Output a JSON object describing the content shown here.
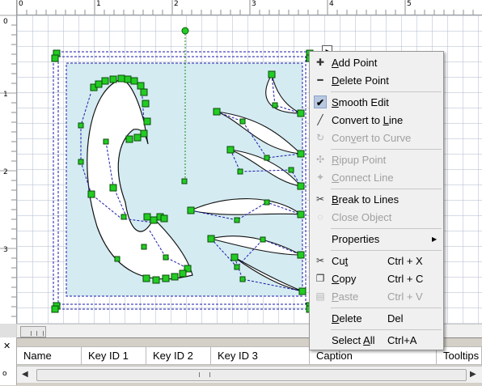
{
  "ruler": {
    "top_labels": [
      "0",
      "1",
      "2",
      "3",
      "4",
      "5"
    ],
    "left_labels": [
      "0",
      "1",
      "2",
      "3"
    ]
  },
  "canvas": {
    "background_color": "#ffffff",
    "shape_fill": "#d4ebf2",
    "handle_color": "#22cc22",
    "dashed_color": "#1a1aaa"
  },
  "context_menu": {
    "items": [
      {
        "label": "Add Point",
        "mnemonic": "A",
        "icon": "add-point-icon",
        "enabled": true
      },
      {
        "label": "Delete Point",
        "mnemonic": "D",
        "icon": "delete-point-icon",
        "enabled": true
      },
      {
        "separator": true
      },
      {
        "label": "Smooth Edit",
        "mnemonic": "S",
        "icon": "checkmark-icon",
        "enabled": true,
        "checked": true
      },
      {
        "label": "Convert to Line",
        "mnemonic": "L",
        "icon": "convert-line-icon",
        "enabled": true
      },
      {
        "label": "Convert to Curve",
        "mnemonic": "v",
        "icon": "convert-curve-icon",
        "enabled": false
      },
      {
        "separator": true
      },
      {
        "label": "Ripup Point",
        "mnemonic": "R",
        "icon": "ripup-point-icon",
        "enabled": false
      },
      {
        "label": "Connect Line",
        "mnemonic": "C",
        "icon": "connect-line-icon",
        "enabled": false
      },
      {
        "separator": true
      },
      {
        "label": "Break to Lines",
        "mnemonic": "B",
        "icon": "break-lines-icon",
        "enabled": true
      },
      {
        "label": "Close Object",
        "mnemonic": "",
        "icon": "close-object-icon",
        "enabled": false
      },
      {
        "separator": true
      },
      {
        "label": "Properties",
        "mnemonic": "",
        "icon": "",
        "enabled": true,
        "submenu": true
      },
      {
        "separator": true
      },
      {
        "label": "Cut",
        "mnemonic": "t",
        "icon": "cut-icon",
        "enabled": true,
        "shortcut": "Ctrl + X"
      },
      {
        "label": "Copy",
        "mnemonic": "C",
        "icon": "copy-icon",
        "enabled": true,
        "shortcut": "Ctrl + C"
      },
      {
        "label": "Paste",
        "mnemonic": "P",
        "icon": "paste-icon",
        "enabled": false,
        "shortcut": "Ctrl + V"
      },
      {
        "separator": true
      },
      {
        "label": "Delete",
        "mnemonic": "D",
        "icon": "",
        "enabled": true,
        "shortcut": "Del"
      },
      {
        "separator": true
      },
      {
        "label": "Select All",
        "mnemonic": "A",
        "icon": "",
        "enabled": true,
        "shortcut": "Ctrl+A"
      }
    ]
  },
  "data_grid": {
    "columns": [
      "Name",
      "Key ID 1",
      "Key ID 2",
      "Key ID 3",
      "Caption",
      "Tooltips"
    ]
  },
  "bottom_panel": {
    "side_label": "o"
  }
}
